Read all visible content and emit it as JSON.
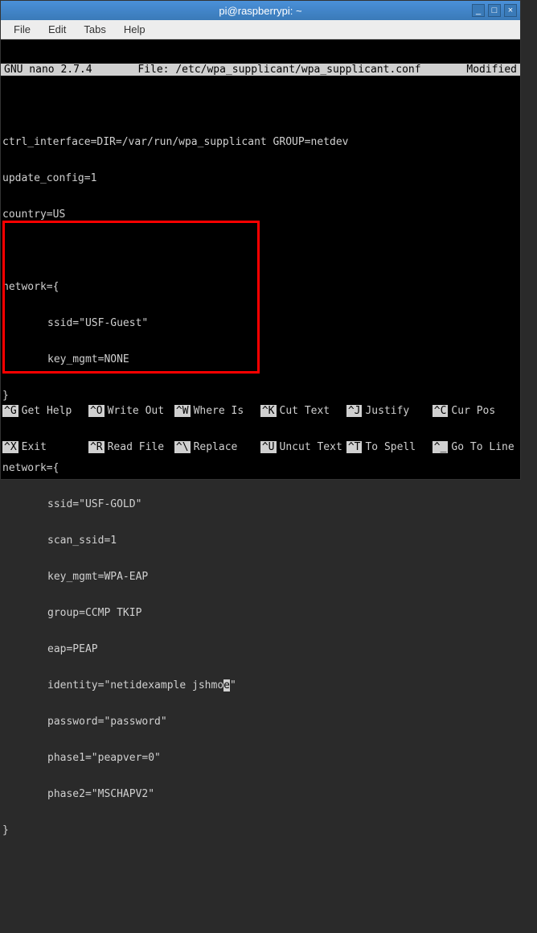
{
  "titlebar": {
    "title": "pi@raspberrypi: ~"
  },
  "menubar": {
    "file": "File",
    "edit": "Edit",
    "tabs": "Tabs",
    "help": "Help"
  },
  "nano": {
    "app": "GNU nano 2.7.4",
    "file_label": "File: /etc/wpa_supplicant/wpa_supplicant.conf",
    "status": "Modified"
  },
  "content": {
    "l1": "ctrl_interface=DIR=/var/run/wpa_supplicant GROUP=netdev",
    "l2": "update_config=1",
    "l3": "country=US",
    "l4": "",
    "l5": "network={",
    "l6": "ssid=\"USF-Guest\"",
    "l7": "key_mgmt=NONE",
    "l8": "}",
    "l9": "",
    "l10": "network={",
    "l11": "ssid=\"USF-GOLD\"",
    "l12": "scan_ssid=1",
    "l13": "key_mgmt=WPA-EAP",
    "l14": "group=CCMP TKIP",
    "l15": "eap=PEAP",
    "l16a": "identity=\"netidexample jshmo",
    "l16b": "e",
    "l16c": "\"",
    "l17": "password=\"password\"",
    "l18": "phase1=\"peapver=0\"",
    "l19": "phase2=\"MSCHAPV2\"",
    "l20": "}"
  },
  "footer": {
    "r1c1k": "^G",
    "r1c1l": "Get Help",
    "r1c2k": "^O",
    "r1c2l": "Write Out",
    "r1c3k": "^W",
    "r1c3l": "Where Is",
    "r1c4k": "^K",
    "r1c4l": "Cut Text",
    "r1c5k": "^J",
    "r1c5l": "Justify",
    "r1c6k": "^C",
    "r1c6l": "Cur Pos",
    "r2c1k": "^X",
    "r2c1l": "Exit",
    "r2c2k": "^R",
    "r2c2l": "Read File",
    "r2c3k": "^\\",
    "r2c3l": "Replace",
    "r2c4k": "^U",
    "r2c4l": "Uncut Text",
    "r2c5k": "^T",
    "r2c5l": "To Spell",
    "r2c6k": "^_",
    "r2c6l": "Go To Line"
  }
}
